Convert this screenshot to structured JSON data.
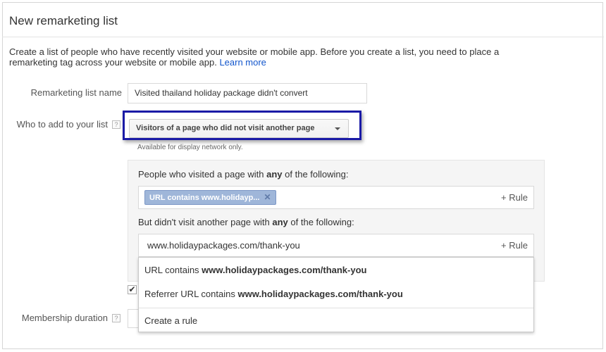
{
  "title": "New remarketing list",
  "description": {
    "text": "Create a list of people who have recently visited your website or mobile app. Before you create a list, you need to place a remarketing tag across your website or mobile app.",
    "link": "Learn more"
  },
  "fields": {
    "name_label": "Remarketing list name",
    "name_value": "Visited thailand holiday package didn't convert",
    "who_label": "Who to add to your list",
    "who_value": "Visitors of a page who did not visit another page",
    "who_note": "Available for display network only.",
    "duration_label": "Membership duration",
    "help_icon": "?"
  },
  "rules": {
    "visited_prefix": "People who visited a page with ",
    "visited_bold": "any",
    "visited_suffix": " of the following:",
    "visited_chip": "URL contains www.holidayp...",
    "chip_close": "✕",
    "add_rule": "+ Rule",
    "not_visited_prefix": "But didn't visit another page with ",
    "not_visited_bold": "any",
    "not_visited_suffix": " of the following:",
    "not_visited_input": "www.holidaypackages.com/thank-you"
  },
  "suggestions": [
    {
      "prefix": "URL contains ",
      "bold": "www.holidaypackages.com/thank-you"
    },
    {
      "prefix": "Referrer URL contains ",
      "bold": "www.holidaypackages.com/thank-you"
    },
    {
      "prefix": "Create a rule",
      "bold": ""
    }
  ],
  "checkbox_mark": "✔",
  "colors": {
    "link": "#1155cc",
    "highlight_border": "#1a1aa6",
    "chip_bg": "#9fb6d9"
  }
}
